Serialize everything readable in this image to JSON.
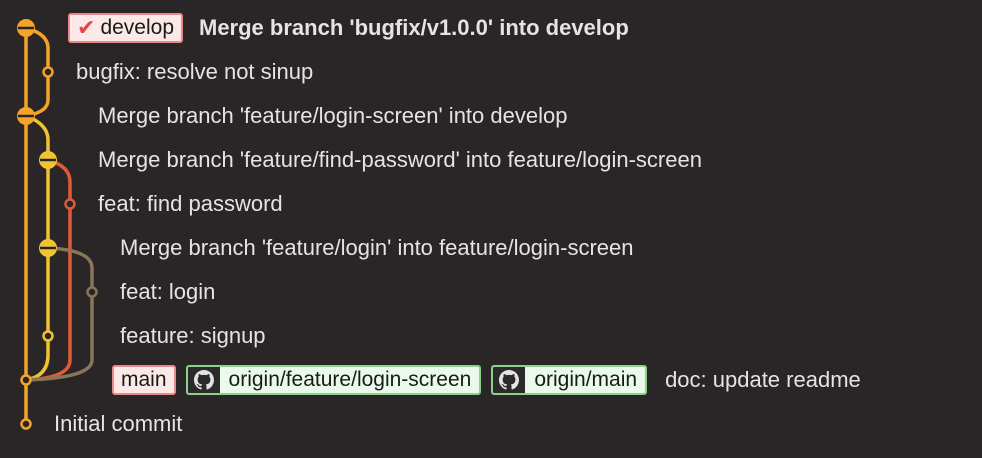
{
  "colors": {
    "background": "#2a2628",
    "branch_main": "#f3a327",
    "branch_feature": "#f1c232",
    "branch_find_password": "#e05a3a",
    "branch_login": "#8a7559",
    "ref_local_bg": "#fde8e8",
    "ref_local_border": "#e98a8a",
    "ref_remote_bg": "#eafaea",
    "ref_remote_border": "#8ecf8a",
    "head_check": "#e0474c"
  },
  "commits": [
    {
      "message": "Merge branch 'bugfix/v1.0.0' into develop",
      "bold": true,
      "refs": [
        {
          "name": "develop",
          "type": "local-head",
          "icon": "check-icon"
        }
      ]
    },
    {
      "message": "bugfix: resolve not sinup",
      "bold": false,
      "refs": []
    },
    {
      "message": "Merge branch 'feature/login-screen' into develop",
      "bold": false,
      "refs": []
    },
    {
      "message": "Merge branch 'feature/find-password' into feature/login-screen",
      "bold": false,
      "refs": []
    },
    {
      "message": "feat: find password",
      "bold": false,
      "refs": []
    },
    {
      "message": "Merge branch 'feature/login' into feature/login-screen",
      "bold": false,
      "refs": []
    },
    {
      "message": "feat: login",
      "bold": false,
      "refs": []
    },
    {
      "message": "feature: signup",
      "bold": false,
      "refs": []
    },
    {
      "message": "doc: update readme",
      "bold": false,
      "refs": [
        {
          "name": "main",
          "type": "local"
        },
        {
          "name": "origin/feature/login-screen",
          "type": "remote",
          "icon": "github-icon"
        },
        {
          "name": "origin/main",
          "type": "remote",
          "icon": "github-icon"
        }
      ]
    },
    {
      "message": "Initial commit",
      "bold": false,
      "refs": []
    }
  ]
}
